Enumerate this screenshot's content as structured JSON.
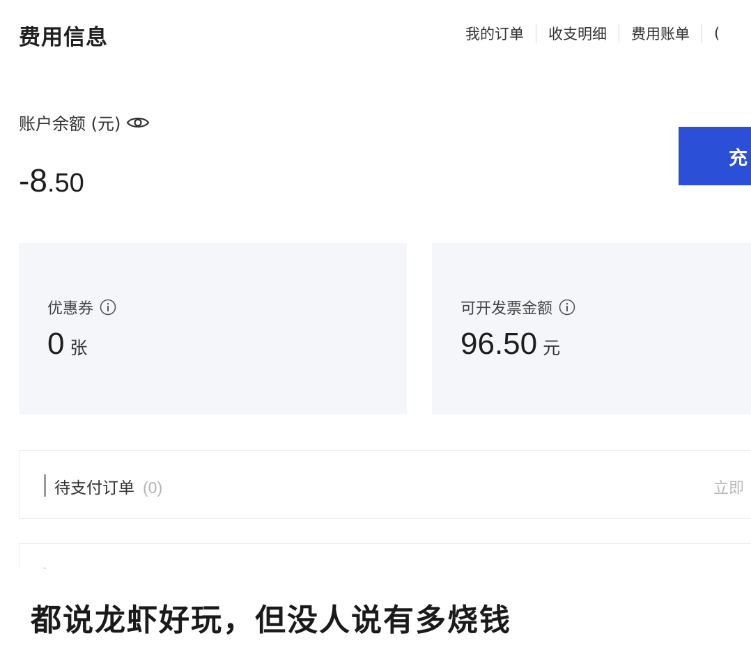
{
  "header": {
    "title": "费用信息",
    "nav": [
      "我的订单",
      "收支明细",
      "费用账单",
      "("
    ]
  },
  "balance": {
    "label": "账户余额 (元)",
    "icon": "eye-icon",
    "value_int": "-8",
    "value_dec": ".50",
    "recharge_label": "充",
    "recharge_color": "#2b4fd6"
  },
  "cards": {
    "coupon": {
      "label": "优惠券",
      "icon": "info-icon",
      "value": "0",
      "unit": "张"
    },
    "invoice": {
      "label": "可开发票金额",
      "icon": "info-icon",
      "value": "96.50",
      "unit": "元"
    }
  },
  "pending": {
    "title": "待支付订单",
    "count": "(0)",
    "action": "立即"
  },
  "caption": "都说龙虾好玩，但没人说有多烧钱"
}
